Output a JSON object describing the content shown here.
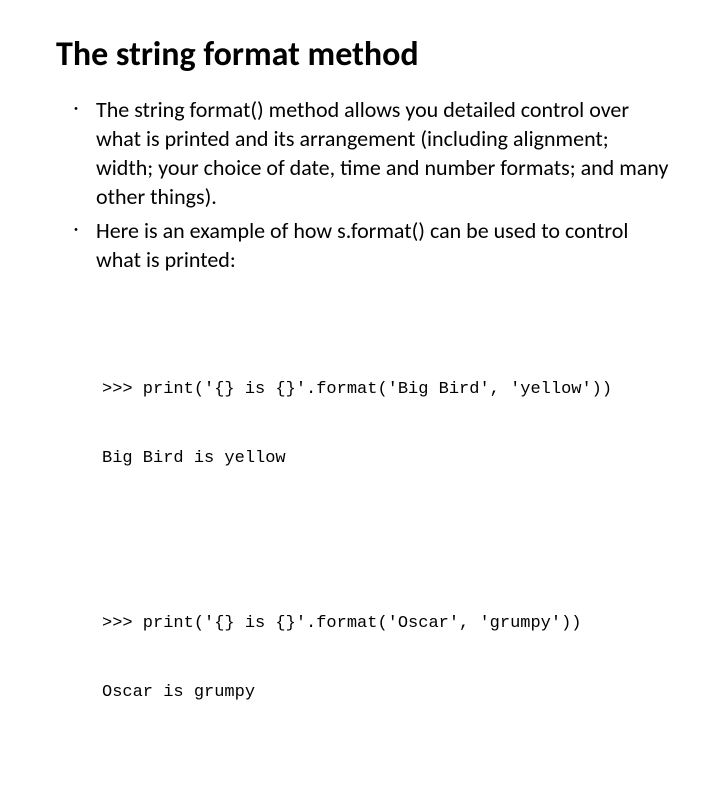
{
  "slide": {
    "title": "The string format method",
    "bullets": [
      "The string format() method allows you detailed control over what is printed and its arrangement (including alignment; width; your choice of date, time and number formats; and many other things).",
      "Here is an example of how s.format() can be used to control what is printed:"
    ],
    "code": [
      {
        "line1": ">>> print('{} is {}'.format('Big Bird', 'yellow'))",
        "line2": "Big Bird is yellow"
      },
      {
        "line1": ">>> print('{} is {}'.format('Oscar', 'grumpy'))",
        "line2": "Oscar is grumpy"
      }
    ]
  }
}
